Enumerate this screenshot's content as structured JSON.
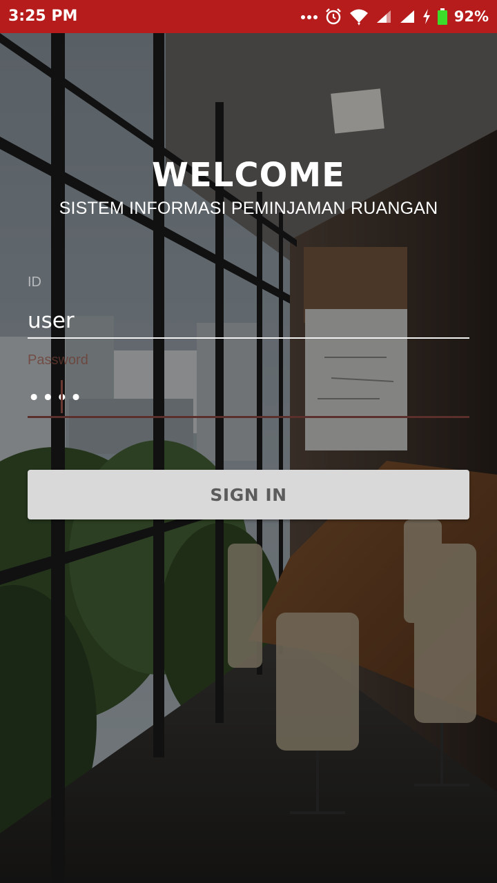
{
  "status_bar": {
    "time": "3:25 PM",
    "battery_percent": "92%",
    "icons": [
      "more-dots-icon",
      "alarm-icon",
      "wifi-icon",
      "signal-icon",
      "signal-icon",
      "charging-icon",
      "battery-icon"
    ],
    "background_color": "#b71c1c"
  },
  "header": {
    "title": "WELCOME",
    "subtitle": "SISTEM INFORMASI PEMINJAMAN RUANGAN"
  },
  "form": {
    "id_label": "ID",
    "id_value": "user",
    "password_label": "Password",
    "password_value": "••••",
    "submit_label": "SIGN IN"
  },
  "colors": {
    "button_bg": "#d8d9d8",
    "button_text": "#5c5c5c",
    "active_underline": "#5a2f2c"
  }
}
